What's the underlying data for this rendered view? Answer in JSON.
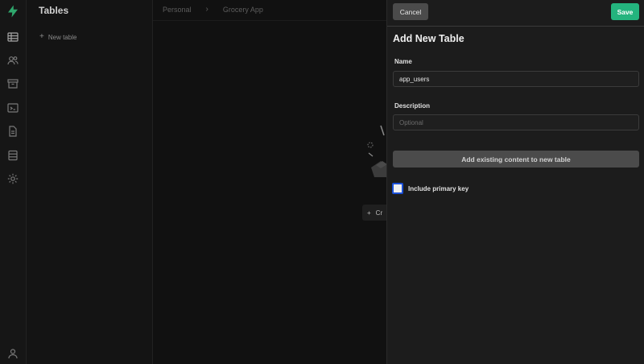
{
  "sidebar": {
    "title": "Tables",
    "new_table_label": "New table",
    "icons": [
      "bolt-logo-icon",
      "table-icon",
      "users-icon",
      "archive-icon",
      "terminal-icon",
      "document-icon",
      "database-icon",
      "settings-icon",
      "user-icon"
    ]
  },
  "breadcrumb": {
    "org": "Personal",
    "project": "Grocery App"
  },
  "main": {
    "create_button_label": "Cr"
  },
  "panel": {
    "cancel_label": "Cancel",
    "save_label": "Save",
    "title": "Add New Table",
    "name_label": "Name",
    "name_value": "app_users",
    "description_label": "Description",
    "description_placeholder": "Optional",
    "add_existing_label": "Add existing content to new table",
    "primary_key_label": "Include primary key",
    "primary_key_checked": false
  },
  "colors": {
    "accent": "#24b47e",
    "checkbox_border": "#1a4fd6"
  }
}
